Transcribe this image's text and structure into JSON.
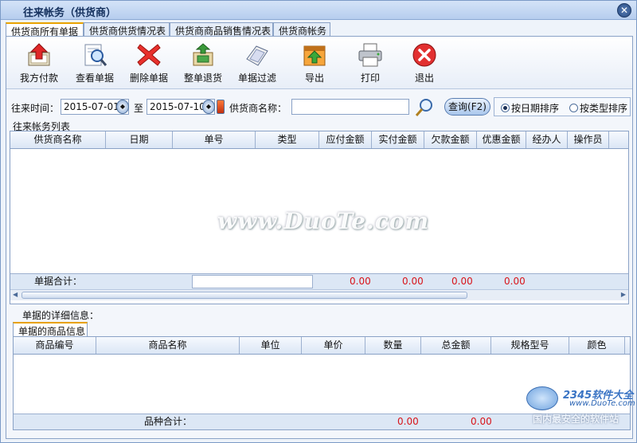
{
  "window": {
    "title": "往来帐务（供货商）",
    "close_icon": "close-icon"
  },
  "tabs": [
    {
      "label": "供货商所有单据",
      "active": true
    },
    {
      "label": "供货商供货情况表",
      "active": false
    },
    {
      "label": "供货商商品销售情况表",
      "active": false
    },
    {
      "label": "供货商帐务",
      "active": false
    }
  ],
  "toolbar": {
    "pay": {
      "label": "我方付款",
      "icon": "upload-payment-icon"
    },
    "view": {
      "label": "查看单据",
      "icon": "magnify-document-icon"
    },
    "delete": {
      "label": "删除单据",
      "icon": "delete-x-icon"
    },
    "return": {
      "label": "整单退货",
      "icon": "return-goods-icon"
    },
    "filter": {
      "label": "单据过滤",
      "icon": "filter-document-icon"
    },
    "export": {
      "label": "导出",
      "icon": "export-icon"
    },
    "print": {
      "label": "打印",
      "icon": "printer-icon"
    },
    "exit": {
      "label": "退出",
      "icon": "exit-icon"
    }
  },
  "filter": {
    "time_label": "往来时间：",
    "date_from": "2015-07-01",
    "to_label": "至",
    "date_to": "2015-07-10",
    "supplier_label": "供货商名称：",
    "supplier_value": "",
    "query_label": "查询(F2)",
    "sort_date_label": "按日期排序",
    "sort_type_label": "按类型排序",
    "sort_selected": "date"
  },
  "ledger": {
    "group_label": "往来帐务列表",
    "columns": [
      "供货商名称",
      "日期",
      "单号",
      "类型",
      "应付金额",
      "实付金额",
      "欠款金额",
      "优惠金额",
      "经办人",
      "操作员"
    ],
    "rows": [],
    "footer": {
      "label": "单据合计：",
      "payable": "0.00",
      "paid": "0.00",
      "owed": "0.00",
      "discount": "0.00"
    }
  },
  "detail": {
    "section_label": "单据的详细信息：",
    "tab_label": "单据的商品信息",
    "columns": [
      "商品编号",
      "商品名称",
      "单位",
      "单价",
      "数量",
      "总金额",
      "规格型号",
      "颜色"
    ],
    "rows": [],
    "footer": {
      "label": "品种合计：",
      "quantity": "0.00",
      "total": "0.00"
    }
  },
  "overlay": {
    "watermark": "www.DuoTe.com",
    "brand_line1": "2345软件大全",
    "brand_line2": "www.DuoTe.com",
    "brand_line3": "国内最安全的软件站"
  },
  "colors": {
    "accent_red": "#d8141a",
    "title_blue": "#15315e",
    "border_blue": "#8aa2c6"
  }
}
